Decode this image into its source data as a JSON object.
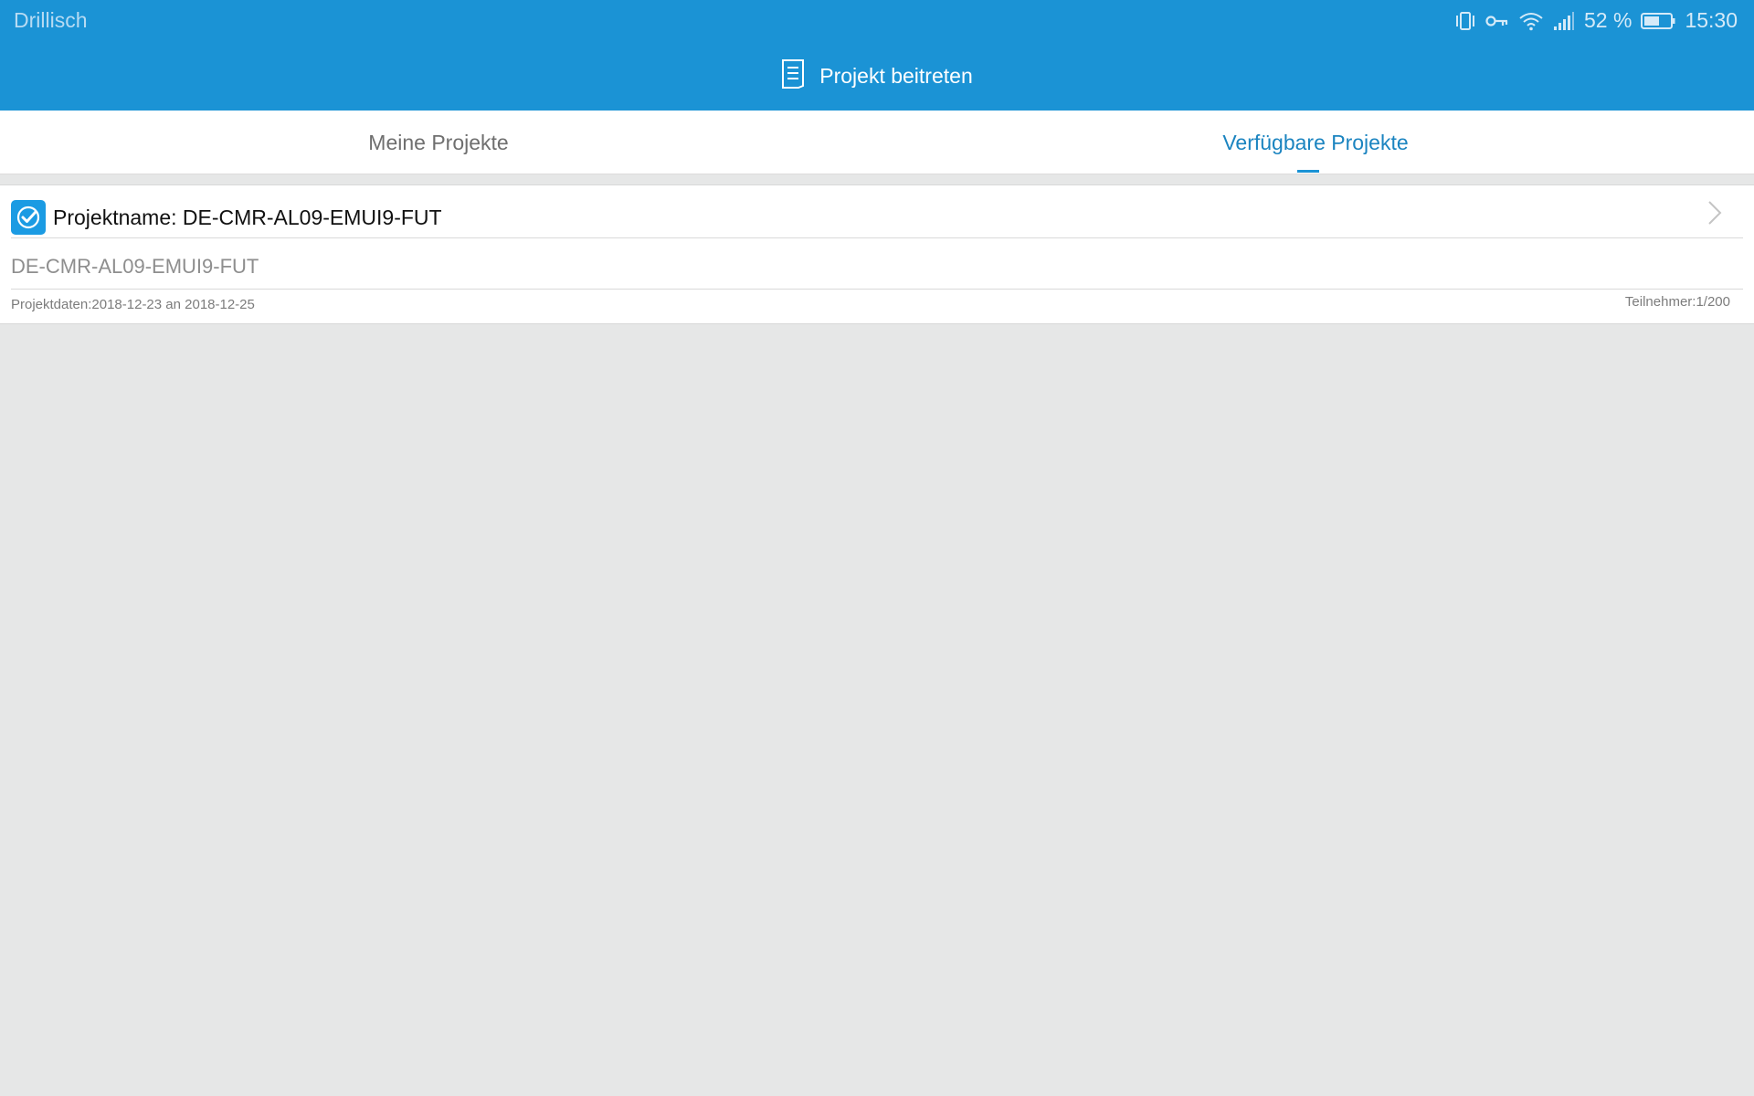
{
  "status_bar": {
    "carrier": "Drillisch",
    "battery_percent": "52 %",
    "time": "15:30",
    "icons": [
      "vibrate-icon",
      "vpn-key-icon",
      "wifi-icon",
      "signal-icon",
      "battery-icon"
    ]
  },
  "header": {
    "title": "Projekt beitreten",
    "icon": "document-icon"
  },
  "tabs": [
    {
      "label": "Meine Projekte",
      "active": false
    },
    {
      "label": "Verfügbare Projekte",
      "active": true
    }
  ],
  "projects": [
    {
      "name_label": "Projektname: DE-CMR-AL09-EMUI9-FUT",
      "subtitle": "DE-CMR-AL09-EMUI9-FUT",
      "dates": "Projektdaten:2018-12-23 an 2018-12-25",
      "participants": "Teilnehmer:1/200",
      "icon": "checked-badge-icon"
    }
  ],
  "colors": {
    "primary": "#1b93d5",
    "active_tab_text": "#1b84c0",
    "background": "#e6e7e7"
  }
}
